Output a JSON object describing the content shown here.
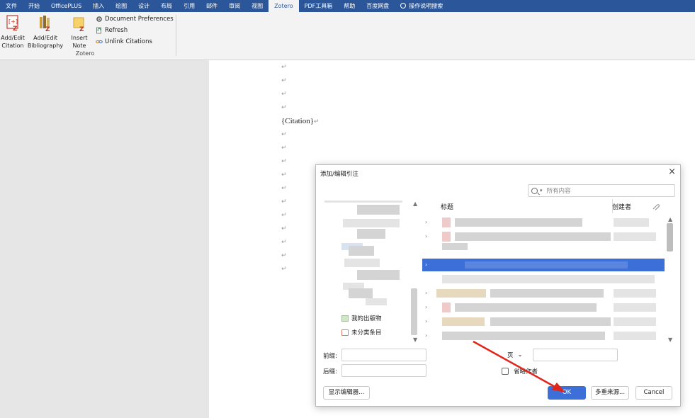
{
  "menubar": {
    "tabs": [
      "文件",
      "开始",
      "OfficePLUS",
      "插入",
      "绘图",
      "设计",
      "布局",
      "引用",
      "邮件",
      "审阅",
      "视图",
      "Zotero",
      "PDF工具箱",
      "帮助",
      "百度网盘"
    ],
    "active_tab": "Zotero",
    "tell_me": "操作说明搜索"
  },
  "ribbon": {
    "add_edit_citation": [
      "Add/Edit",
      "Citation"
    ],
    "add_edit_bibliography": [
      "Add/Edit",
      "Bibliography"
    ],
    "insert_note": [
      "Insert",
      "Note"
    ],
    "document_preferences": "Document Preferences",
    "refresh": "Refresh",
    "unlink_citations": "Unlink Citations",
    "group_label": "Zotero"
  },
  "document": {
    "paragraph_mark": "↵",
    "citation_text": "{Citation}"
  },
  "dialog": {
    "title": "添加/编辑引注",
    "close": "×",
    "search_placeholder": "所有内容",
    "columns": {
      "title": "标题",
      "creator": "创建者"
    },
    "library": {
      "my_publications": "我的出版物",
      "unfiled_items": "未分类条目"
    },
    "prefix_label": "前缀:",
    "suffix_label": "后缀:",
    "locator_select": "页",
    "omit_author_label": "省略作者",
    "show_editor_button": "显示编辑器...",
    "ok_button": "OK",
    "multiple_sources_button": "多重来源...",
    "cancel_button": "Cancel"
  },
  "colors": {
    "ribbon_blue": "#2b579a",
    "selection_blue": "#3d6fd9",
    "annotation_red": "#e0251b"
  }
}
